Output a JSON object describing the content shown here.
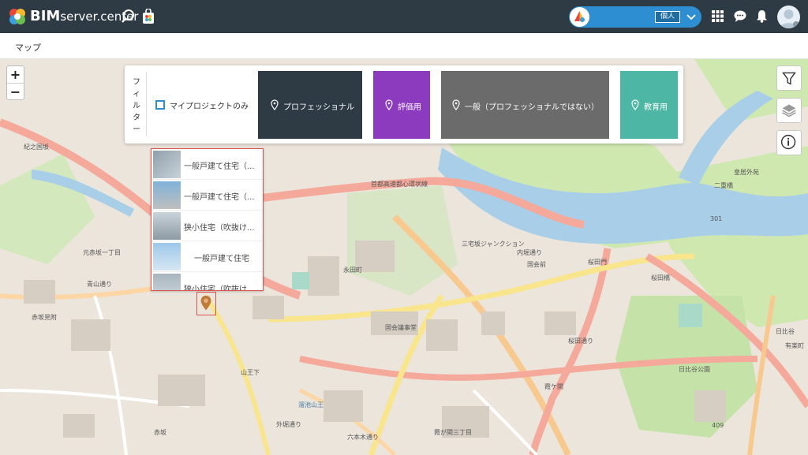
{
  "topbar": {
    "brand_bold": "BIM",
    "brand_light": "server.center",
    "profile_badge": "個人"
  },
  "breadcrumb": {
    "title": "マップ"
  },
  "filter": {
    "title_chars": [
      "フ",
      "ィ",
      "ル",
      "タ",
      "ー"
    ],
    "my_projects_label": "マイプロジェクトのみ",
    "buttons": [
      {
        "label": "プロフェッショナル",
        "color": "#2e3a44"
      },
      {
        "label": "評価用",
        "color": "#8c3bbf"
      },
      {
        "label": "一般（プロフェッショナルではない）",
        "color": "#6b6b6b"
      },
      {
        "label": "教育用",
        "color": "#4db6a4"
      }
    ]
  },
  "projects": [
    {
      "name": "一般戸建て住宅（..."
    },
    {
      "name": "一般戸建て住宅（..."
    },
    {
      "name": "狭小住宅（吹抜け..."
    },
    {
      "name": "一般戸建て住宅"
    },
    {
      "name": "狭小住宅（吹抜け..."
    }
  ],
  "zoom": {
    "in": "+",
    "out": "−"
  },
  "map_labels": [
    {
      "text": "永田町",
      "cls": ""
    },
    {
      "text": "国会議事堂",
      "cls": ""
    },
    {
      "text": "霞ケ関",
      "cls": ""
    },
    {
      "text": "桜田門",
      "cls": ""
    },
    {
      "text": "日比谷公園",
      "cls": ""
    },
    {
      "text": "赤坂",
      "cls": ""
    },
    {
      "text": "溜池山王",
      "cls": "blue"
    },
    {
      "text": "皇居外苑",
      "cls": ""
    },
    {
      "text": "二重橋",
      "cls": ""
    },
    {
      "text": "日比谷",
      "cls": ""
    },
    {
      "text": "有楽町",
      "cls": ""
    },
    {
      "text": "赤坂見附",
      "cls": ""
    },
    {
      "text": "山王下",
      "cls": ""
    },
    {
      "text": "三宅坂ジャンクション",
      "cls": ""
    },
    {
      "text": "首都高速都心環状線",
      "cls": ""
    },
    {
      "text": "青山通り",
      "cls": ""
    },
    {
      "text": "内堀通り",
      "cls": ""
    },
    {
      "text": "桜田通り",
      "cls": ""
    },
    {
      "text": "六本木通り",
      "cls": ""
    },
    {
      "text": "外堀通り",
      "cls": ""
    },
    {
      "text": "301",
      "cls": ""
    },
    {
      "text": "409",
      "cls": ""
    },
    {
      "text": "国会前",
      "cls": ""
    },
    {
      "text": "霞が関三丁目",
      "cls": ""
    },
    {
      "text": "元赤坂一丁目",
      "cls": ""
    },
    {
      "text": "紀之国坂",
      "cls": ""
    },
    {
      "text": "桜田橋",
      "cls": ""
    }
  ]
}
